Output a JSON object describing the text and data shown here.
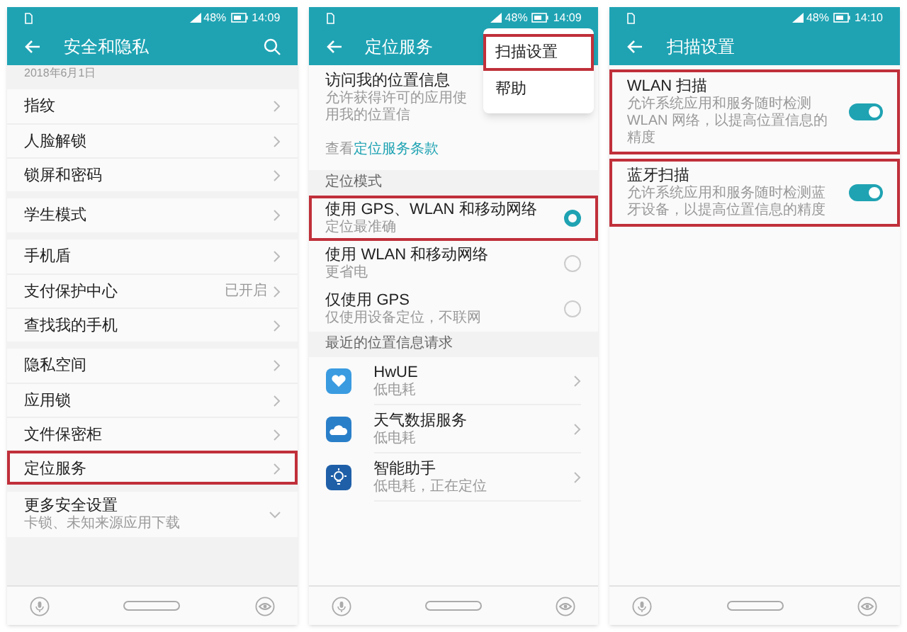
{
  "security_screen": {
    "status_bar": {
      "battery": "48%",
      "time": "14:09"
    },
    "header": {
      "title": "安全和隐私"
    },
    "date": "2018年6月1日",
    "groups": [
      {
        "items": [
          {
            "label": "指纹",
            "kind": "link",
            "highlighted": false
          },
          {
            "label": "人脸解锁",
            "kind": "link",
            "highlighted": false
          },
          {
            "label": "锁屏和密码",
            "kind": "link",
            "highlighted": false
          }
        ]
      },
      {
        "items": [
          {
            "label": "学生模式",
            "kind": "link",
            "highlighted": false
          }
        ]
      },
      {
        "items": [
          {
            "label": "手机盾",
            "kind": "link",
            "highlighted": false
          },
          {
            "label": "支付保护中心",
            "value": "已开启",
            "kind": "link",
            "highlighted": false
          },
          {
            "label": "查找我的手机",
            "kind": "link",
            "highlighted": false
          }
        ]
      },
      {
        "items": [
          {
            "label": "隐私空间",
            "kind": "link",
            "highlighted": false
          },
          {
            "label": "应用锁",
            "kind": "link",
            "highlighted": false
          },
          {
            "label": "文件保密柜",
            "kind": "link",
            "highlighted": false
          },
          {
            "label": "定位服务",
            "kind": "link",
            "highlighted": true
          }
        ]
      },
      {
        "items": [
          {
            "label": "更多安全设置",
            "sub": "卡锁、未知来源应用下载",
            "kind": "expand",
            "highlighted": false
          }
        ]
      }
    ]
  },
  "location_screen": {
    "status_bar": {
      "battery": "48%",
      "time": "14:09"
    },
    "header": {
      "title": "定位服务"
    },
    "menu": [
      {
        "label": "扫描设置",
        "highlighted": true
      },
      {
        "label": "帮助",
        "highlighted": false
      }
    ],
    "access": {
      "title": "访问我的位置信息",
      "description": "允许获得许可的应用使用我的位置信",
      "terms_prefix": "查看",
      "terms_link": "定位服务条款"
    },
    "mode_section": "定位模式",
    "modes": [
      {
        "label": "使用 GPS、WLAN 和移动网络",
        "sub": "定位最准确",
        "selected": true,
        "highlighted": true
      },
      {
        "label": "使用 WLAN 和移动网络",
        "sub": "更省电",
        "selected": false,
        "highlighted": false
      },
      {
        "label": "仅使用 GPS",
        "sub": "仅使用设备定位，不联网",
        "selected": false,
        "highlighted": false
      }
    ],
    "recent_section": "最近的位置信息请求",
    "apps": [
      {
        "name": "HwUE",
        "sub": "低电耗",
        "kind": "heart"
      },
      {
        "name": "天气数据服务",
        "sub": "低电耗",
        "kind": "cloud"
      },
      {
        "name": "智能助手",
        "sub": "低电耗，正在定位",
        "kind": "bulb"
      }
    ]
  },
  "scan_screen": {
    "status_bar": {
      "battery": "48%",
      "time": "14:10"
    },
    "header": {
      "title": "扫描设置"
    },
    "toggles": [
      {
        "label": "WLAN 扫描",
        "description": "允许系统应用和服务随时检测 WLAN 网络，以提高位置信息的精度",
        "on": true,
        "highlighted": true
      },
      {
        "label": "蓝牙扫描",
        "description": "允许系统应用和服务随时检测蓝牙设备，以提高位置信息的精度",
        "on": true,
        "highlighted": true
      }
    ]
  }
}
